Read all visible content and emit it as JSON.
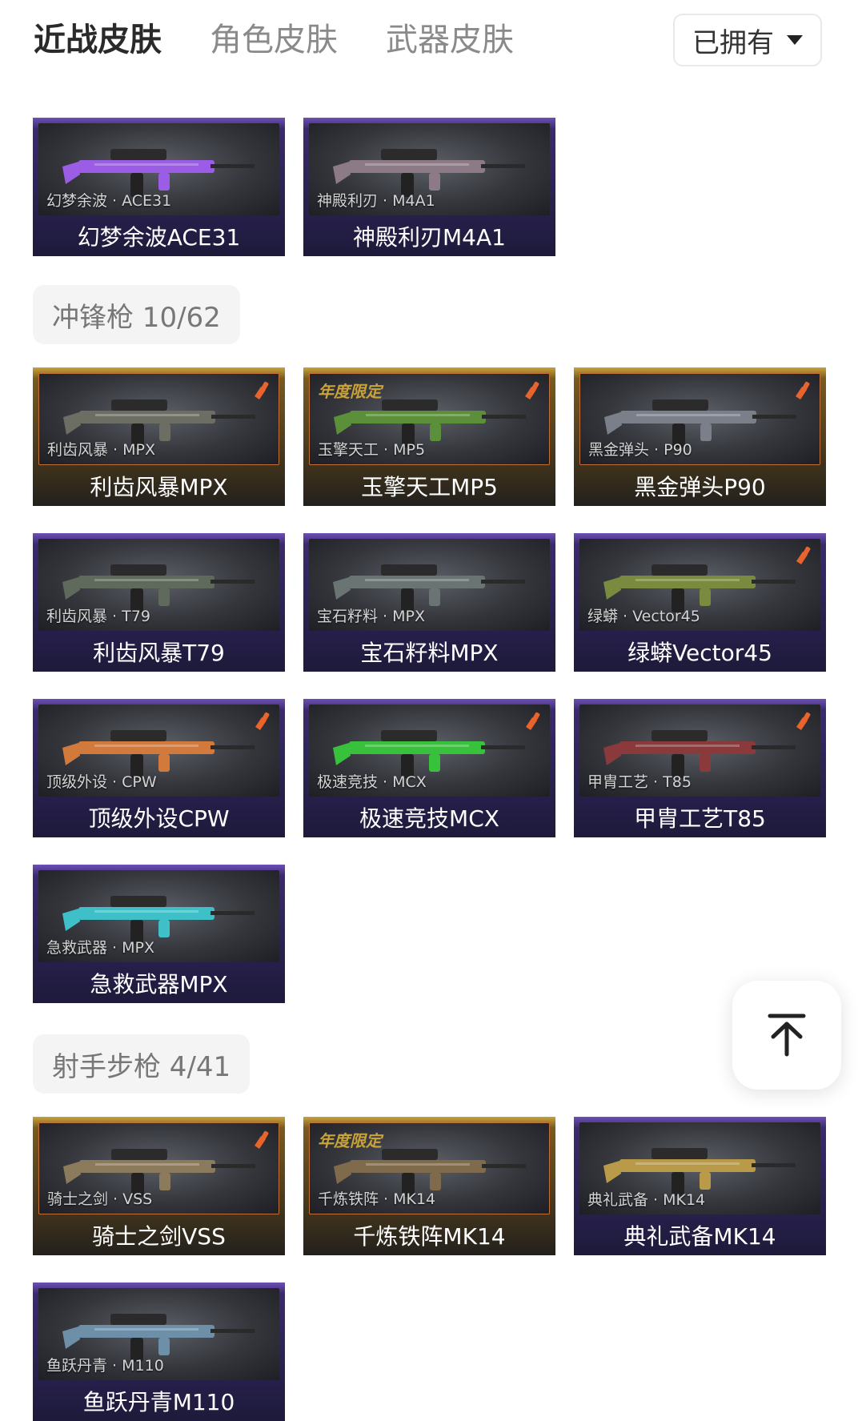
{
  "tabs": [
    "近战皮肤",
    "角色皮肤",
    "武器皮肤"
  ],
  "filter": {
    "label": "已拥有"
  },
  "sections": [
    {
      "title": "",
      "cards": [
        {
          "style": "purple",
          "sub": "幻梦余波 · ACE31",
          "name": "幻梦余波ACE31",
          "gun_color": "#9b5de5",
          "badge": false,
          "limited": ""
        },
        {
          "style": "purple",
          "sub": "神殿利刃 · M4A1",
          "name": "神殿利刃M4A1",
          "gun_color": "#8c7a86",
          "badge": false,
          "limited": ""
        }
      ]
    },
    {
      "title": "冲锋枪 10/62",
      "cards": [
        {
          "style": "gold",
          "sub": "利齿风暴 · MPX",
          "name": "利齿风暴MPX",
          "gun_color": "#6c6e63",
          "badge": true,
          "limited": ""
        },
        {
          "style": "gold",
          "sub": "玉擎天工 · MP5",
          "name": "玉擎天工MP5",
          "gun_color": "#5b8f3a",
          "badge": true,
          "limited": "年度限定"
        },
        {
          "style": "gold",
          "sub": "黑金弹头 · P90",
          "name": "黑金弹头P90",
          "gun_color": "#7b7f8a",
          "badge": true,
          "limited": ""
        },
        {
          "style": "purple",
          "sub": "利齿风暴 · T79",
          "name": "利齿风暴T79",
          "gun_color": "#5f6a5c",
          "badge": false,
          "limited": ""
        },
        {
          "style": "purple",
          "sub": "宝石籽料 · MPX",
          "name": "宝石籽料MPX",
          "gun_color": "#6a7473",
          "badge": false,
          "limited": ""
        },
        {
          "style": "purple",
          "sub": "绿蟒 · Vector45",
          "name": "绿蟒Vector45",
          "gun_color": "#7a8a3e",
          "badge": true,
          "limited": ""
        },
        {
          "style": "purple",
          "sub": "顶级外设 · CPW",
          "name": "顶级外设CPW",
          "gun_color": "#d27a3c",
          "badge": true,
          "limited": ""
        },
        {
          "style": "purple",
          "sub": "极速竞技 · MCX",
          "name": "极速竞技MCX",
          "gun_color": "#38c23c",
          "badge": true,
          "limited": ""
        },
        {
          "style": "purple",
          "sub": "甲胄工艺 · T85",
          "name": "甲胄工艺T85",
          "gun_color": "#8a3a3a",
          "badge": true,
          "limited": ""
        },
        {
          "style": "purple",
          "sub": "急救武器 · MPX",
          "name": "急救武器MPX",
          "gun_color": "#3fc0c8",
          "badge": false,
          "limited": ""
        }
      ]
    },
    {
      "title": "射手步枪 4/41",
      "cards": [
        {
          "style": "gold",
          "sub": "骑士之剑 · VSS",
          "name": "骑士之剑VSS",
          "gun_color": "#8c7a5c",
          "badge": true,
          "limited": ""
        },
        {
          "style": "gold",
          "sub": "千炼铁阵 · MK14",
          "name": "千炼铁阵MK14",
          "gun_color": "#7f6a4c",
          "badge": false,
          "limited": "年度限定"
        },
        {
          "style": "purple",
          "sub": "典礼武备 · MK14",
          "name": "典礼武备MK14",
          "gun_color": "#b99a48",
          "badge": false,
          "limited": ""
        },
        {
          "style": "purple",
          "sub": "鱼跃丹青 · M110",
          "name": "鱼跃丹青M110",
          "gun_color": "#6e8fa8",
          "badge": false,
          "limited": ""
        }
      ]
    }
  ]
}
